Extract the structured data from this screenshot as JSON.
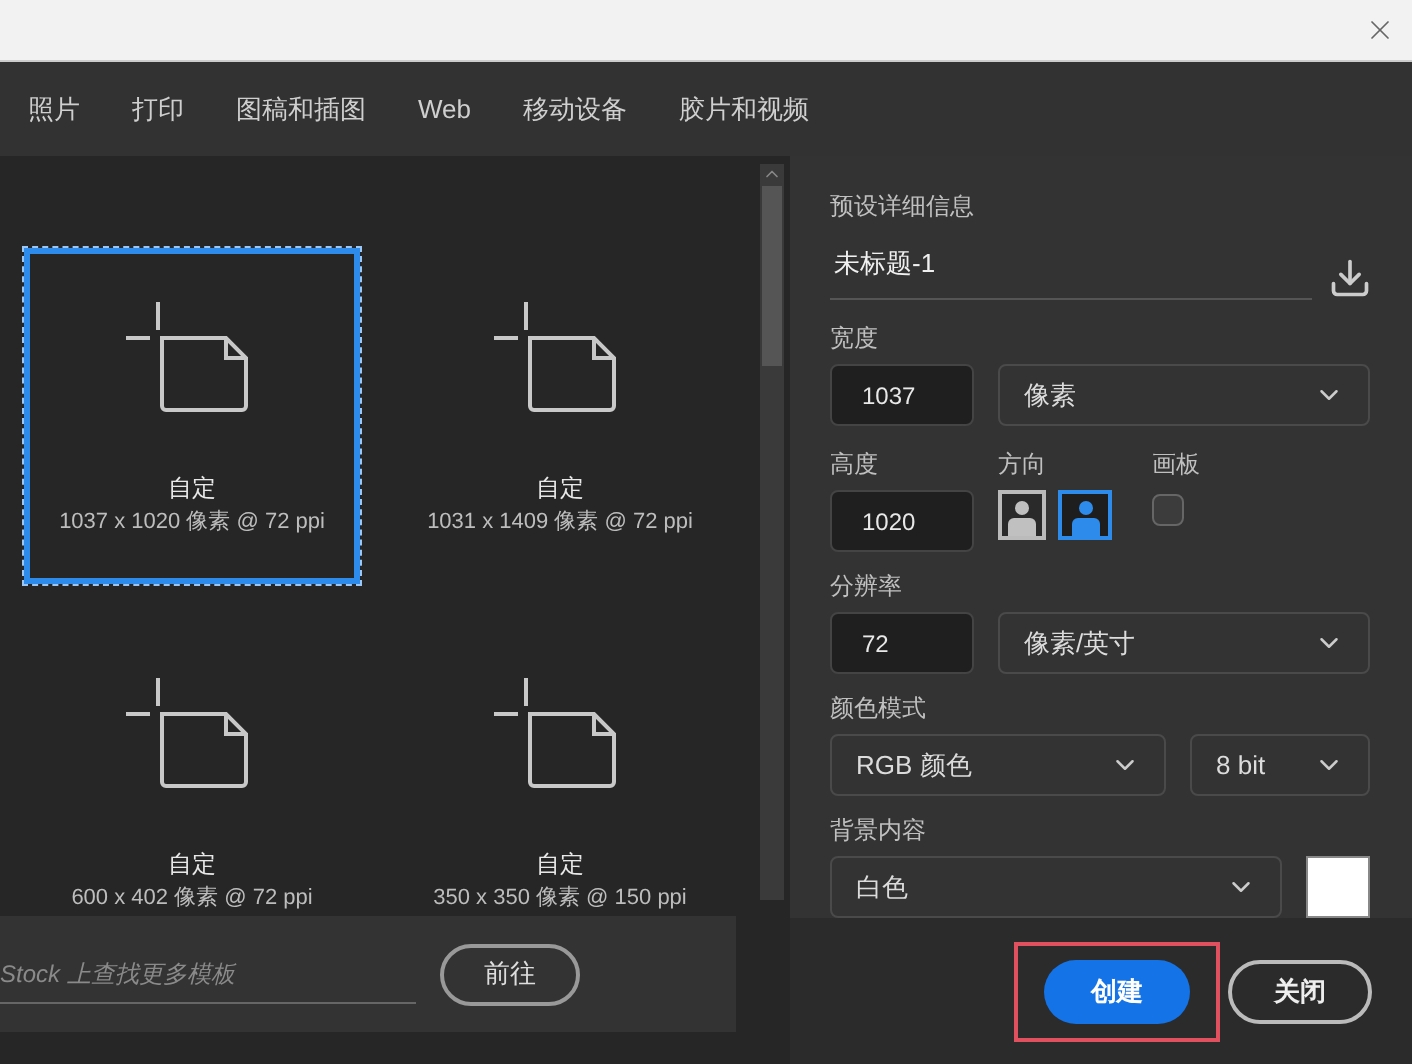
{
  "tabs": [
    {
      "label": "照片"
    },
    {
      "label": "打印"
    },
    {
      "label": "图稿和插图"
    },
    {
      "label": "Web"
    },
    {
      "label": "移动设备"
    },
    {
      "label": "胶片和视频"
    }
  ],
  "presets": [
    {
      "name": "自定",
      "size": "1037 x 1020 像素 @ 72 ppi",
      "selected": true
    },
    {
      "name": "自定",
      "size": "1031 x 1409 像素 @ 72 ppi",
      "selected": false
    },
    {
      "name": "自定",
      "size": "600 x 402 像素 @ 72 ppi",
      "selected": false
    },
    {
      "name": "自定",
      "size": "350 x 350 像素 @ 150 ppi",
      "selected": false
    }
  ],
  "stock": {
    "placeholder": "Stock 上查找更多模板",
    "button": "前往"
  },
  "details": {
    "title": "预设详细信息",
    "name": "未标题-1",
    "width": {
      "label": "宽度",
      "value": "1037",
      "unit": "像素"
    },
    "height": {
      "label": "高度",
      "value": "1020"
    },
    "orientation": {
      "label": "方向",
      "options": [
        {
          "kind": "portrait",
          "selected": false
        },
        {
          "kind": "landscape",
          "selected": true
        }
      ]
    },
    "artboard": {
      "label": "画板",
      "checked": false
    },
    "resolution": {
      "label": "分辨率",
      "value": "72",
      "unit": "像素/英寸"
    },
    "color_mode": {
      "label": "颜色模式",
      "mode": "RGB 颜色",
      "depth": "8 bit"
    },
    "background": {
      "label": "背景内容",
      "value": "白色",
      "color": "#ffffff"
    }
  },
  "buttons": [
    {
      "label": "创建",
      "kind": "primary",
      "highlighted": true
    },
    {
      "label": "关闭",
      "kind": "secondary",
      "highlighted": false
    }
  ]
}
